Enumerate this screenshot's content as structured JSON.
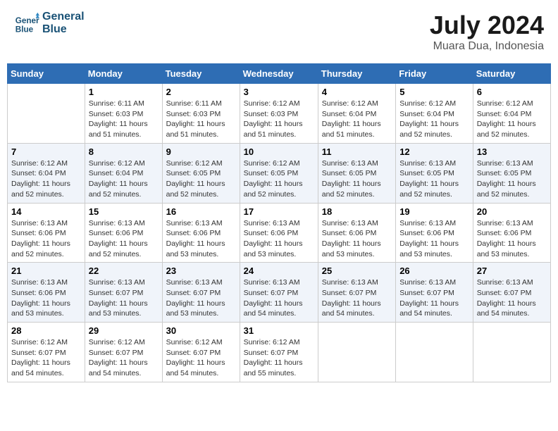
{
  "header": {
    "logo_line1": "General",
    "logo_line2": "Blue",
    "month": "July 2024",
    "location": "Muara Dua, Indonesia"
  },
  "weekdays": [
    "Sunday",
    "Monday",
    "Tuesday",
    "Wednesday",
    "Thursday",
    "Friday",
    "Saturday"
  ],
  "weeks": [
    [
      {
        "day": "",
        "info": ""
      },
      {
        "day": "1",
        "info": "Sunrise: 6:11 AM\nSunset: 6:03 PM\nDaylight: 11 hours\nand 51 minutes."
      },
      {
        "day": "2",
        "info": "Sunrise: 6:11 AM\nSunset: 6:03 PM\nDaylight: 11 hours\nand 51 minutes."
      },
      {
        "day": "3",
        "info": "Sunrise: 6:12 AM\nSunset: 6:03 PM\nDaylight: 11 hours\nand 51 minutes."
      },
      {
        "day": "4",
        "info": "Sunrise: 6:12 AM\nSunset: 6:04 PM\nDaylight: 11 hours\nand 51 minutes."
      },
      {
        "day": "5",
        "info": "Sunrise: 6:12 AM\nSunset: 6:04 PM\nDaylight: 11 hours\nand 52 minutes."
      },
      {
        "day": "6",
        "info": "Sunrise: 6:12 AM\nSunset: 6:04 PM\nDaylight: 11 hours\nand 52 minutes."
      }
    ],
    [
      {
        "day": "7",
        "info": "Sunrise: 6:12 AM\nSunset: 6:04 PM\nDaylight: 11 hours\nand 52 minutes."
      },
      {
        "day": "8",
        "info": "Sunrise: 6:12 AM\nSunset: 6:04 PM\nDaylight: 11 hours\nand 52 minutes."
      },
      {
        "day": "9",
        "info": "Sunrise: 6:12 AM\nSunset: 6:05 PM\nDaylight: 11 hours\nand 52 minutes."
      },
      {
        "day": "10",
        "info": "Sunrise: 6:12 AM\nSunset: 6:05 PM\nDaylight: 11 hours\nand 52 minutes."
      },
      {
        "day": "11",
        "info": "Sunrise: 6:13 AM\nSunset: 6:05 PM\nDaylight: 11 hours\nand 52 minutes."
      },
      {
        "day": "12",
        "info": "Sunrise: 6:13 AM\nSunset: 6:05 PM\nDaylight: 11 hours\nand 52 minutes."
      },
      {
        "day": "13",
        "info": "Sunrise: 6:13 AM\nSunset: 6:05 PM\nDaylight: 11 hours\nand 52 minutes."
      }
    ],
    [
      {
        "day": "14",
        "info": "Sunrise: 6:13 AM\nSunset: 6:06 PM\nDaylight: 11 hours\nand 52 minutes."
      },
      {
        "day": "15",
        "info": "Sunrise: 6:13 AM\nSunset: 6:06 PM\nDaylight: 11 hours\nand 52 minutes."
      },
      {
        "day": "16",
        "info": "Sunrise: 6:13 AM\nSunset: 6:06 PM\nDaylight: 11 hours\nand 53 minutes."
      },
      {
        "day": "17",
        "info": "Sunrise: 6:13 AM\nSunset: 6:06 PM\nDaylight: 11 hours\nand 53 minutes."
      },
      {
        "day": "18",
        "info": "Sunrise: 6:13 AM\nSunset: 6:06 PM\nDaylight: 11 hours\nand 53 minutes."
      },
      {
        "day": "19",
        "info": "Sunrise: 6:13 AM\nSunset: 6:06 PM\nDaylight: 11 hours\nand 53 minutes."
      },
      {
        "day": "20",
        "info": "Sunrise: 6:13 AM\nSunset: 6:06 PM\nDaylight: 11 hours\nand 53 minutes."
      }
    ],
    [
      {
        "day": "21",
        "info": "Sunrise: 6:13 AM\nSunset: 6:06 PM\nDaylight: 11 hours\nand 53 minutes."
      },
      {
        "day": "22",
        "info": "Sunrise: 6:13 AM\nSunset: 6:07 PM\nDaylight: 11 hours\nand 53 minutes."
      },
      {
        "day": "23",
        "info": "Sunrise: 6:13 AM\nSunset: 6:07 PM\nDaylight: 11 hours\nand 53 minutes."
      },
      {
        "day": "24",
        "info": "Sunrise: 6:13 AM\nSunset: 6:07 PM\nDaylight: 11 hours\nand 54 minutes."
      },
      {
        "day": "25",
        "info": "Sunrise: 6:13 AM\nSunset: 6:07 PM\nDaylight: 11 hours\nand 54 minutes."
      },
      {
        "day": "26",
        "info": "Sunrise: 6:13 AM\nSunset: 6:07 PM\nDaylight: 11 hours\nand 54 minutes."
      },
      {
        "day": "27",
        "info": "Sunrise: 6:13 AM\nSunset: 6:07 PM\nDaylight: 11 hours\nand 54 minutes."
      }
    ],
    [
      {
        "day": "28",
        "info": "Sunrise: 6:12 AM\nSunset: 6:07 PM\nDaylight: 11 hours\nand 54 minutes."
      },
      {
        "day": "29",
        "info": "Sunrise: 6:12 AM\nSunset: 6:07 PM\nDaylight: 11 hours\nand 54 minutes."
      },
      {
        "day": "30",
        "info": "Sunrise: 6:12 AM\nSunset: 6:07 PM\nDaylight: 11 hours\nand 54 minutes."
      },
      {
        "day": "31",
        "info": "Sunrise: 6:12 AM\nSunset: 6:07 PM\nDaylight: 11 hours\nand 55 minutes."
      },
      {
        "day": "",
        "info": ""
      },
      {
        "day": "",
        "info": ""
      },
      {
        "day": "",
        "info": ""
      }
    ]
  ]
}
